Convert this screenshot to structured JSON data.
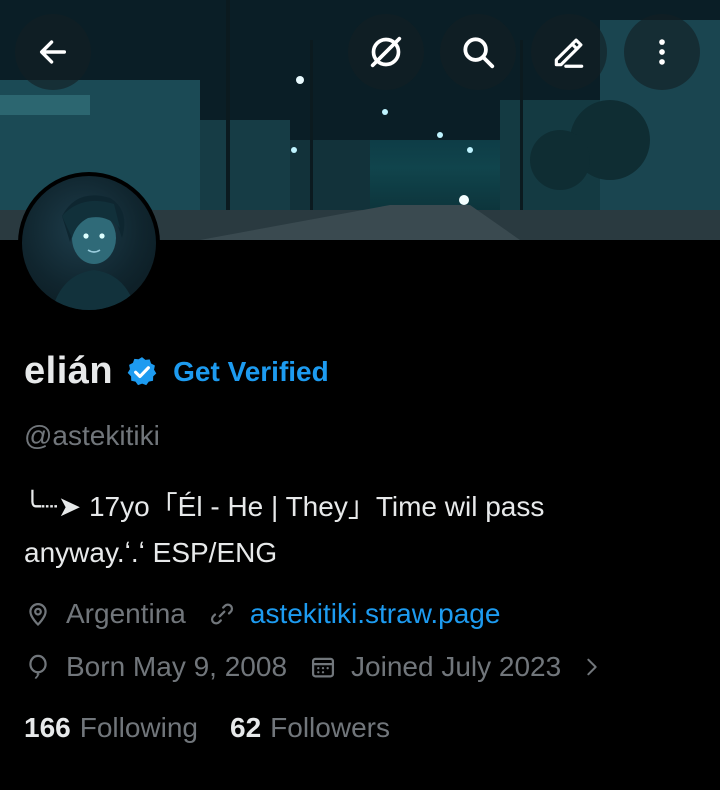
{
  "header": {
    "back_icon": "arrow-left-icon",
    "grok_icon": "grok-icon",
    "search_icon": "search-icon",
    "edit_icon": "edit-pencil-icon",
    "more_icon": "more-vertical-icon"
  },
  "profile": {
    "name": "elián",
    "verified_badge_icon": "verified-badge-icon",
    "get_verified": "Get Verified",
    "handle": "@astekitiki",
    "bio_line1": "╰┈➤ 17yo「Él - He | They」Time wil pass",
    "bio_line2": "anyway.ʻ.ʻ ESP/ENG",
    "location": "Argentina",
    "website": "astekitiki.straw.page",
    "born": "Born May 9, 2008",
    "joined": "Joined July 2023",
    "following_count": "166",
    "following_label": "Following",
    "followers_count": "62",
    "followers_label": "Followers"
  },
  "colors": {
    "background": "#000000",
    "text_primary": "#e7e9ea",
    "text_secondary": "#71767b",
    "accent": "#1d9bf0"
  }
}
